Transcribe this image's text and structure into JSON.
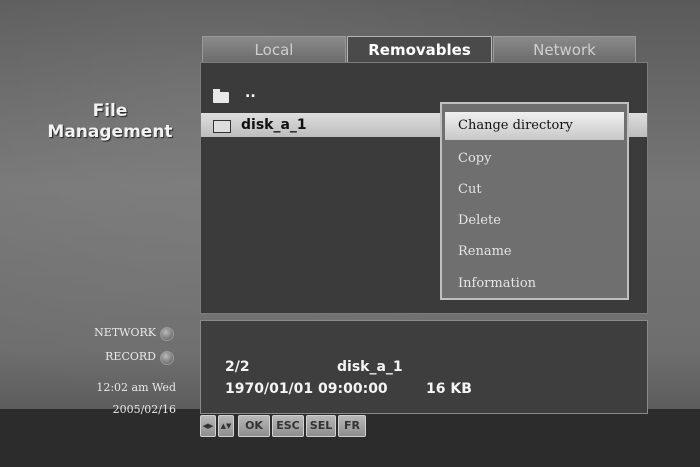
{
  "sidebar": {
    "title": "File Management"
  },
  "tabs": [
    {
      "label": "Local",
      "active": false
    },
    {
      "label": "Removables",
      "active": true
    },
    {
      "label": "Network",
      "active": false
    }
  ],
  "file_list": {
    "parent_label": "..",
    "items": [
      {
        "name": "disk_a_1",
        "type": "folder-icon",
        "selected": true
      }
    ]
  },
  "context_menu": {
    "items": [
      "Change directory",
      "Copy",
      "Cut",
      "Delete",
      "Rename",
      "Information"
    ],
    "selected_index": 0
  },
  "info": {
    "position": "2/2",
    "name": "disk_a_1",
    "datetime": "1970/01/01 09:00:00",
    "size": "16 KB"
  },
  "status": {
    "network_label": "NETWORK",
    "record_label": "RECORD",
    "time": "12:02 am Wed",
    "date": "2005/02/16"
  },
  "keys": {
    "left_right": "◀▶",
    "up_down": "▲▼",
    "ok": "OK",
    "esc": "ESC",
    "sel": "SEL",
    "fr": "FR"
  },
  "colors": {
    "panel": "#3b3b3b",
    "selection": "#d0d0d0",
    "menu": "#6f6f6f"
  }
}
